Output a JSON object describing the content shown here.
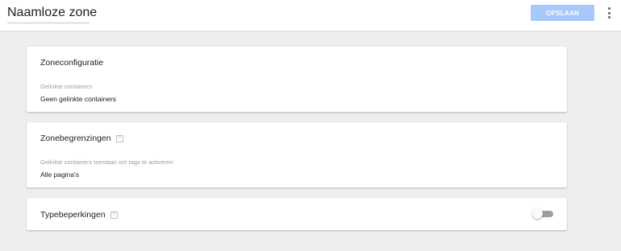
{
  "header": {
    "title": "Naamloze zone",
    "save_label": "OPSLAAN",
    "more_icon": "more-vert-icon"
  },
  "colors": {
    "save_button": "#a8c7fa",
    "background": "#eeeeee"
  },
  "cards": {
    "config": {
      "title": "Zoneconfiguratie",
      "field_label": "Gelinkte containers",
      "field_value": "Geen gelinkte containers"
    },
    "boundaries": {
      "title": "Zonebegrenzingen",
      "help": "?",
      "field_label": "Gelinkte containers toestaan om tags te activeren",
      "field_value": "Alle pagina's"
    },
    "types": {
      "title": "Typebeperkingen",
      "help": "?",
      "toggle_on": false
    }
  }
}
